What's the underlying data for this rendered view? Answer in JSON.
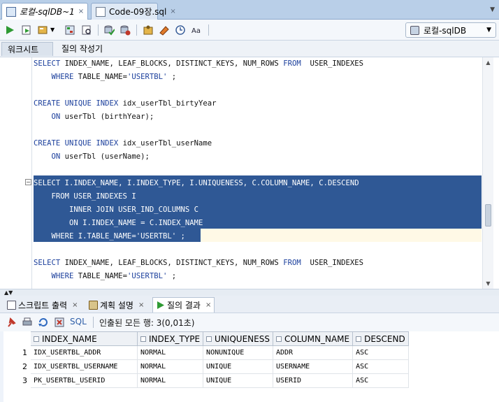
{
  "doc_tabs": [
    {
      "label": "로컬-sqlDB~1",
      "close": "×"
    },
    {
      "label": "Code-09장.sql",
      "close": "×"
    }
  ],
  "connection": {
    "value": "로컬-sqlDB",
    "arrow": "▼"
  },
  "sub_tabs": [
    "워크시트",
    "질의 작성기"
  ],
  "editor_lines": [
    "SELECT INDEX_NAME, LEAF_BLOCKS, DISTINCT_KEYS, NUM_ROWS FROM  USER_INDEXES",
    "    WHERE TABLE_NAME='USERTBL' ;",
    "",
    "CREATE UNIQUE INDEX idx_userTbl_birtyYear",
    "    ON userTbl (birthYear);",
    "",
    "CREATE UNIQUE INDEX idx_userTbl_userName",
    "    ON userTbl (userName);",
    "",
    "SELECT I.INDEX_NAME, I.INDEX_TYPE, I.UNIQUENESS, C.COLUMN_NAME, C.DESCEND",
    "    FROM USER_INDEXES I",
    "        INNER JOIN USER_IND_COLUMNS C",
    "        ON I.INDEX_NAME = C.INDEX_NAME",
    "    WHERE I.TABLE_NAME='USERTBL' ;",
    "",
    "SELECT INDEX_NAME, LEAF_BLOCKS, DISTINCT_KEYS, NUM_ROWS FROM  USER_INDEXES",
    "    WHERE TABLE_NAME='USERTBL' ;"
  ],
  "collapse_marker": "−",
  "result_tabs": [
    {
      "label": "스크립트 출력",
      "close": "×"
    },
    {
      "label": "계획 설명",
      "close": "×"
    },
    {
      "label": "질의 결과",
      "close": "×"
    }
  ],
  "results_toolbar": {
    "sql_label": "SQL",
    "status": "인출된 모든 행: 3(0,01초)"
  },
  "grid": {
    "columns": [
      "INDEX_NAME",
      "INDEX_TYPE",
      "UNIQUENESS",
      "COLUMN_NAME",
      "DESCEND"
    ],
    "rows": [
      {
        "n": "1",
        "cells": [
          "IDX_USERTBL_ADDR",
          "NORMAL",
          "NONUNIQUE",
          "ADDR",
          "ASC"
        ]
      },
      {
        "n": "2",
        "cells": [
          "IDX_USERTBL_USERNAME",
          "NORMAL",
          "UNIQUE",
          "USERNAME",
          "ASC"
        ]
      },
      {
        "n": "3",
        "cells": [
          "PK_USERTBL_USERID",
          "NORMAL",
          "UNIQUE",
          "USERID",
          "ASC"
        ]
      }
    ]
  },
  "icons": {
    "run": "run-statement-icon",
    "script": "run-script-icon",
    "commit": "commit-icon",
    "rollback": "rollback-icon",
    "accent": "#2f5895"
  }
}
